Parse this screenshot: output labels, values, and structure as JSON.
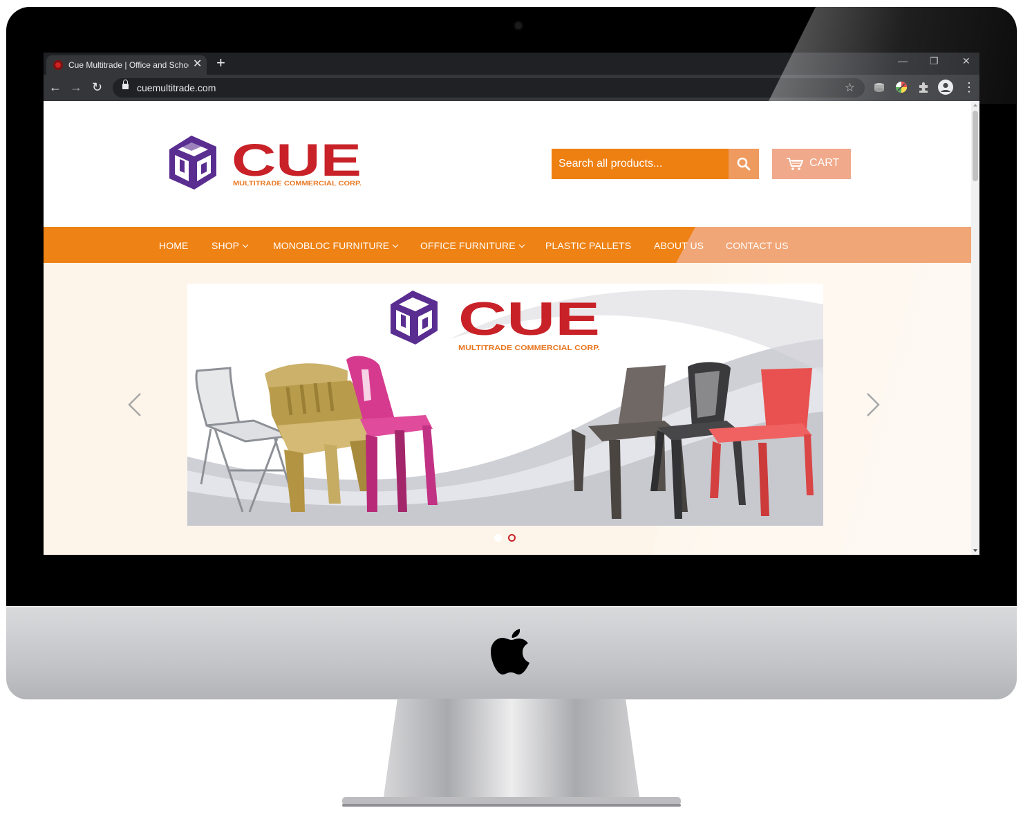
{
  "browser": {
    "tab_title": "Cue Multitrade | Office and School",
    "new_tab_symbol": "+",
    "close_symbol": "✕",
    "url": "cuemultitrade.com",
    "window_controls": {
      "minimize": "—",
      "restore": "❐",
      "close": "✕"
    },
    "nav": {
      "back": "←",
      "forward": "→",
      "reload": "↻"
    },
    "bookmark_star": "☆",
    "menu": "⋮",
    "extensions": [
      "cast-extension-icon",
      "color-picker-extension-icon",
      "puzzle-extensions-icon",
      "profile-avatar-icon"
    ]
  },
  "site": {
    "logo": {
      "wordmark": "CUE",
      "tagline": "MULTITRADE COMMERCIAL CORP."
    },
    "search": {
      "placeholder": "Search all products..."
    },
    "cart": {
      "label": "CART"
    },
    "nav": [
      {
        "label": "HOME",
        "has_dropdown": false
      },
      {
        "label": "SHOP",
        "has_dropdown": true
      },
      {
        "label": "MONOBLOC FURNITURE",
        "has_dropdown": true
      },
      {
        "label": "OFFICE FURNITURE",
        "has_dropdown": true
      },
      {
        "label": "PLASTIC PALLETS",
        "has_dropdown": false
      },
      {
        "label": "ABOUT US",
        "has_dropdown": false
      },
      {
        "label": "CONTACT US",
        "has_dropdown": false
      }
    ],
    "slideshow": {
      "slide_logo": {
        "wordmark": "CUE",
        "tagline": "MULTITRADE COMMERCIAL CORP."
      },
      "total_slides": 2,
      "active_slide": 2
    }
  },
  "colors": {
    "accent_orange": "#ee8214",
    "logo_red": "#c82228",
    "logo_purple": "#5a2d91",
    "slide_bg": "#fdf5ea",
    "cart_bg": "#f0a98a"
  }
}
